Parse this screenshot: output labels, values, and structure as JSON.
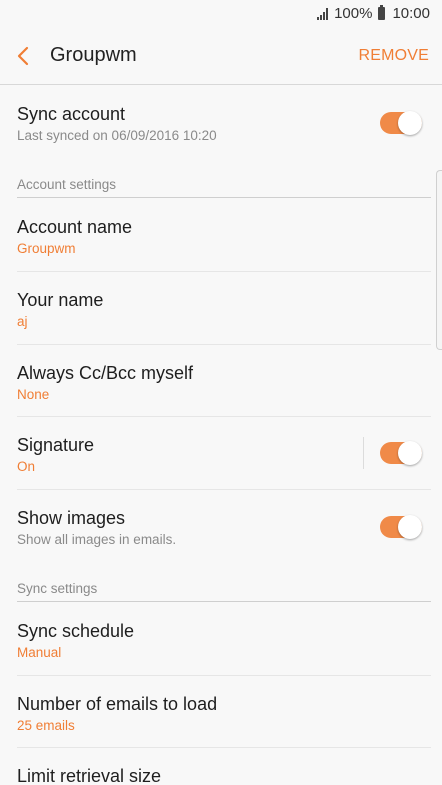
{
  "status": {
    "battery": "100%",
    "time": "10:00"
  },
  "appbar": {
    "title": "Groupwm",
    "remove_label": "REMOVE"
  },
  "sync_account": {
    "title": "Sync account",
    "subtitle": "Last synced on 06/09/2016  10:20",
    "enabled": true
  },
  "sections": {
    "account_settings": "Account settings",
    "sync_settings": "Sync settings"
  },
  "account_name": {
    "title": "Account name",
    "value": "Groupwm"
  },
  "your_name": {
    "title": "Your name",
    "value": "aj"
  },
  "cc_bcc": {
    "title": "Always Cc/Bcc myself",
    "value": "None"
  },
  "signature": {
    "title": "Signature",
    "value": "On",
    "enabled": true
  },
  "show_images": {
    "title": "Show images",
    "subtitle": "Show all images in emails.",
    "enabled": true
  },
  "sync_schedule": {
    "title": "Sync schedule",
    "value": "Manual"
  },
  "emails_to_load": {
    "title": "Number of emails to load",
    "value": "25 emails"
  },
  "limit_retrieval": {
    "title": "Limit retrieval size"
  },
  "colors": {
    "accent": "#f07e35",
    "toggle_on": "#f08a48",
    "background": "#f8f8f8"
  }
}
